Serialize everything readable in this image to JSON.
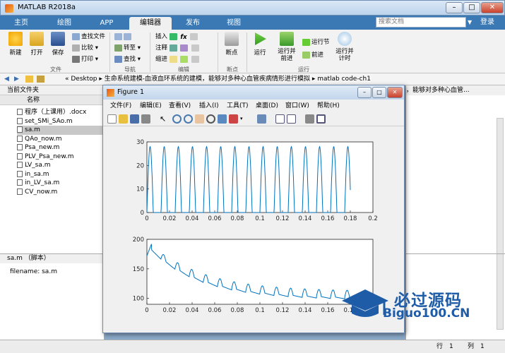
{
  "window": {
    "title": "MATLAB R2018a",
    "minimize": "–",
    "maximize": "□",
    "close": "✕"
  },
  "tabs": [
    "主页",
    "绘图",
    "APP",
    "编辑器",
    "发布",
    "视图"
  ],
  "search": {
    "placeholder": "搜索文档",
    "login": "登录"
  },
  "ribbon": {
    "new": "新建",
    "open": "打开",
    "save": "保存",
    "find_files": "查找文件",
    "compare": "比较",
    "print": "打印",
    "goto": "转至",
    "find": "查找",
    "insert": "插入",
    "comment": "注释",
    "indent": "缩进",
    "breakpoints": "断点",
    "run": "运行",
    "run_advance": "运行并\n前进",
    "run_section": "运行节",
    "advance": "前进",
    "run_time": "运行并\n计时",
    "groups": {
      "file": "文件",
      "nav": "导航",
      "edit": "编辑",
      "breakpoints": "断点",
      "run": "运行"
    }
  },
  "address": {
    "path": "« Desktop ▸ 生命系统建模-血液血环系统的建模，能够对多种心血管疾病情形进行模拟 ▸ matlab code-ch1",
    "right_path": "，能够对多种心血管..."
  },
  "current_folder": {
    "title": "当前文件夹",
    "col_name": "名称",
    "files": [
      "程序（上课用）.docx",
      "set_SMi_SAo.m",
      "sa.m",
      "QAo_now.m",
      "Psa_new.m",
      "PLV_Psa_new.m",
      "LV_sa.m",
      "in_sa.m",
      "in_LV_sa.m",
      "CV_now.m"
    ],
    "selected": "sa.m"
  },
  "details": {
    "title": "sa.m （脚本）",
    "text": "filename: sa.m"
  },
  "figure": {
    "title": "Figure 1",
    "menu": [
      "文件(F)",
      "编辑(E)",
      "查看(V)",
      "插入(I)",
      "工具(T)",
      "桌面(D)",
      "窗口(W)",
      "帮助(H)"
    ]
  },
  "status": {
    "row_label": "行",
    "row": "1",
    "col_label": "列",
    "col": "1"
  },
  "watermark": {
    "cn": "必过源码",
    "en": "Biguo100.CN"
  },
  "chart_data": [
    {
      "type": "line",
      "xlim": [
        0,
        0.2
      ],
      "ylim": [
        0,
        30
      ],
      "xticks": [
        0,
        0.02,
        0.04,
        0.06,
        0.08,
        0.1,
        0.12,
        0.14,
        0.16,
        0.18,
        0.2
      ],
      "yticks": [
        0,
        10,
        20,
        30
      ],
      "color": "#0072bd",
      "pulse_period": 0.0125,
      "pulse_peak": 28,
      "x_end": 0.18
    },
    {
      "type": "line",
      "xlim": [
        0,
        0.2
      ],
      "ylim": [
        90,
        200
      ],
      "xticks": [
        0,
        0.02,
        0.04,
        0.06,
        0.08,
        0.1,
        0.12,
        0.14,
        0.16,
        0.18
      ],
      "yticks": [
        100,
        150,
        200
      ],
      "color": "#0072bd",
      "start_value": 192,
      "floor_value": 102,
      "x_end": 0.18
    }
  ],
  "colors": {
    "tab_bar": "#3a79b4",
    "accent": "#0072bd"
  }
}
